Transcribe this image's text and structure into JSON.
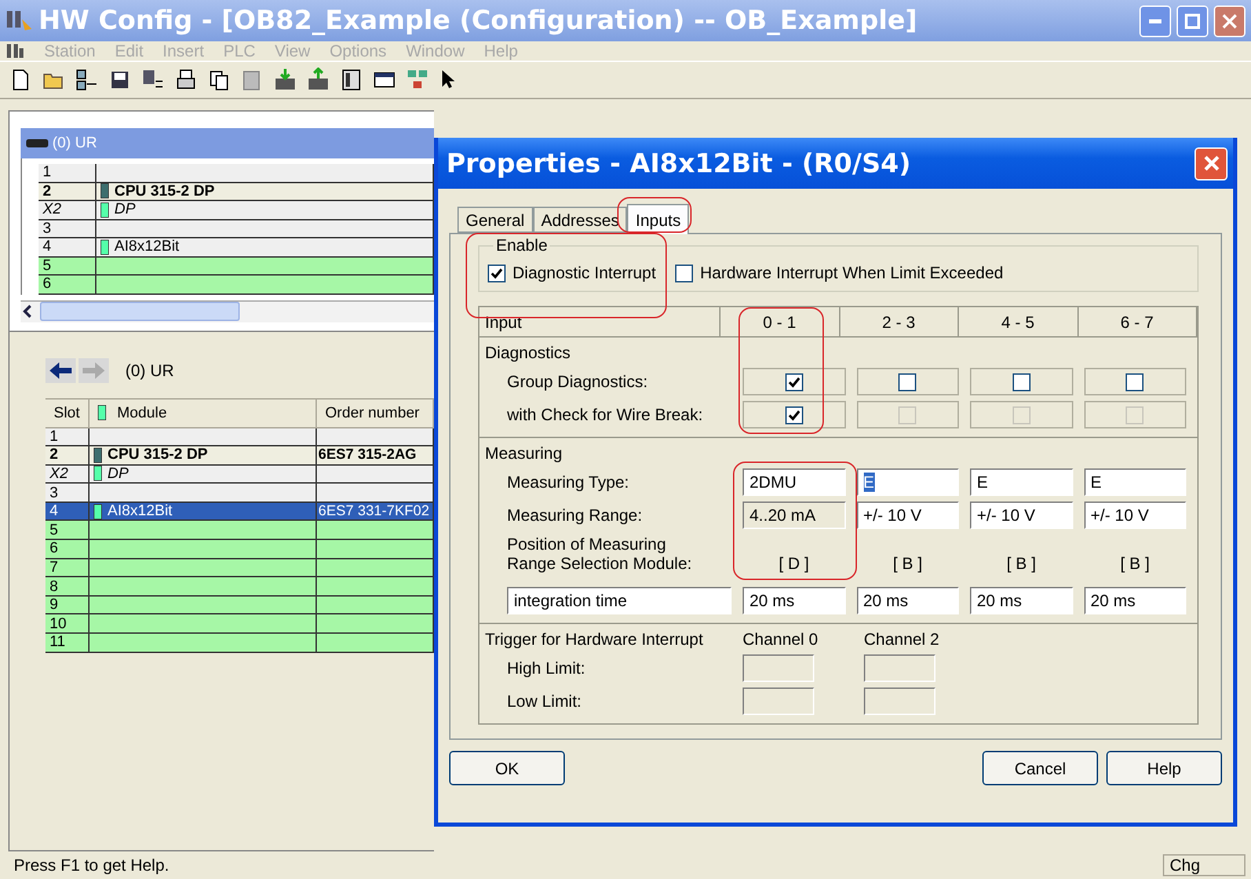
{
  "window": {
    "title": "HW Config - [OB82_Example (Configuration) -- OB_Example]"
  },
  "menu": [
    "Station",
    "Edit",
    "Insert",
    "PLC",
    "View",
    "Options",
    "Window",
    "Help"
  ],
  "rack": {
    "title": "(0) UR",
    "rows": [
      {
        "slot": "1",
        "module": "",
        "kind": "empty"
      },
      {
        "slot": "2",
        "module": "CPU 315-2 DP",
        "kind": "cpu"
      },
      {
        "slot": "X2",
        "module": "DP",
        "kind": "interface"
      },
      {
        "slot": "3",
        "module": "",
        "kind": "empty"
      },
      {
        "slot": "4",
        "module": "AI8x12Bit",
        "kind": "module"
      },
      {
        "slot": "5",
        "module": "",
        "kind": "free"
      },
      {
        "slot": "6",
        "module": "",
        "kind": "free"
      }
    ]
  },
  "station": {
    "title": "(0)  UR",
    "columns": [
      "Slot",
      "Module",
      "Order number"
    ],
    "rows": [
      {
        "slot": "1",
        "module": "",
        "order": "",
        "kind": "empty",
        "selected": false
      },
      {
        "slot": "2",
        "module": "CPU 315-2 DP",
        "order": "6ES7 315-2AG",
        "kind": "cpu",
        "selected": false
      },
      {
        "slot": "X2",
        "module": "DP",
        "order": "",
        "kind": "interface",
        "selected": false
      },
      {
        "slot": "3",
        "module": "",
        "order": "",
        "kind": "empty",
        "selected": false
      },
      {
        "slot": "4",
        "module": "AI8x12Bit",
        "order": "6ES7 331-7KF02",
        "kind": "module",
        "selected": true
      },
      {
        "slot": "5",
        "module": "",
        "order": "",
        "kind": "free",
        "selected": false
      },
      {
        "slot": "6",
        "module": "",
        "order": "",
        "kind": "free",
        "selected": false
      },
      {
        "slot": "7",
        "module": "",
        "order": "",
        "kind": "free",
        "selected": false
      },
      {
        "slot": "8",
        "module": "",
        "order": "",
        "kind": "free",
        "selected": false
      },
      {
        "slot": "9",
        "module": "",
        "order": "",
        "kind": "free",
        "selected": false
      },
      {
        "slot": "10",
        "module": "",
        "order": "",
        "kind": "free",
        "selected": false
      },
      {
        "slot": "11",
        "module": "",
        "order": "",
        "kind": "free",
        "selected": false
      }
    ]
  },
  "status_bar": {
    "text": "Press F1 to get Help.",
    "mode": "Chg"
  },
  "dialog": {
    "title": "Properties - AI8x12Bit - (R0/S4)",
    "tabs": [
      {
        "label": "General",
        "selected": false
      },
      {
        "label": "Addresses",
        "selected": false
      },
      {
        "label": "Inputs",
        "selected": true
      }
    ],
    "enable": {
      "title": "Enable",
      "options": [
        {
          "label": "Diagnostic Interrupt",
          "checked": true
        },
        {
          "label": "Hardware Interrupt When Limit Exceeded",
          "checked": false
        }
      ]
    },
    "input_header": "Input",
    "columns": [
      "0 - 1",
      "2 - 3",
      "4 - 5",
      "6 - 7"
    ],
    "diagnostics": {
      "title": "Diagnostics",
      "rows": [
        {
          "label": "Group Diagnostics:",
          "checks": [
            {
              "checked": true,
              "disabled": false
            },
            {
              "checked": false,
              "disabled": false
            },
            {
              "checked": false,
              "disabled": false
            },
            {
              "checked": false,
              "disabled": false
            }
          ]
        },
        {
          "label": "with Check for Wire Break:",
          "checks": [
            {
              "checked": true,
              "disabled": false
            },
            {
              "checked": false,
              "disabled": true
            },
            {
              "checked": false,
              "disabled": true
            },
            {
              "checked": false,
              "disabled": true
            }
          ]
        }
      ]
    },
    "measuring": {
      "title": "Measuring",
      "type_label": "Measuring Type:",
      "types": [
        {
          "value": "2DMU",
          "selected": false
        },
        {
          "value": "E",
          "selected": true
        },
        {
          "value": "E",
          "selected": false
        },
        {
          "value": "E",
          "selected": false
        }
      ],
      "range_label": "Measuring Range:",
      "ranges": [
        {
          "value": "4..20 mA",
          "disabled": true
        },
        {
          "value": "+/- 10 V",
          "disabled": false
        },
        {
          "value": "+/- 10 V",
          "disabled": false
        },
        {
          "value": "+/- 10 V",
          "disabled": false
        }
      ],
      "position_label": "Position of Measuring Range Selection Module:",
      "positions": [
        "[ D ]",
        "[ B ]",
        "[ B ]",
        "[ B ]"
      ],
      "time_field": "integration time",
      "times": [
        "20 ms",
        "20 ms",
        "20 ms",
        "20 ms"
      ]
    },
    "trigger": {
      "title": "Trigger for Hardware Interrupt",
      "channels": [
        "Channel 0",
        "Channel 2"
      ],
      "limits": [
        "High Limit:",
        "Low Limit:"
      ]
    },
    "buttons": [
      "OK",
      "Cancel",
      "Help"
    ]
  }
}
